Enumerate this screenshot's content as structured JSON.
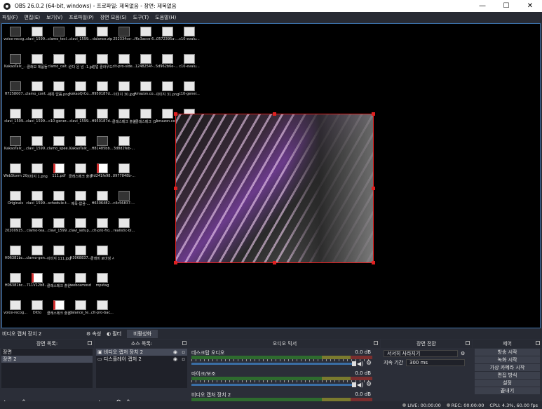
{
  "window": {
    "title": "OBS 26.0.2 (64-bit, windows) - 프로파일: 제목없음 - 장면: 제목없음",
    "minimize": "—",
    "maximize": "☐",
    "close": "✕"
  },
  "menu": [
    "파일(F)",
    "편집(E)",
    "보기(V)",
    "프로파일(P)",
    "장면 모음(S)",
    "도구(T)",
    "도움말(H)"
  ],
  "desktop_icons": [
    {
      "label": "voice-recog...",
      "col": 0,
      "row": 0
    },
    {
      "label": "clavi_1599...",
      "col": 1,
      "row": 0
    },
    {
      "label": "clamo_tecl...",
      "col": 2,
      "row": 0
    },
    {
      "label": "clavi_1599...",
      "col": 3,
      "row": 0
    },
    {
      "label": "dalance.zip",
      "col": 4,
      "row": 0
    },
    {
      "label": "252334ce-...",
      "col": 5,
      "row": 0
    },
    {
      "label": "f6c3acce-6...",
      "col": 6,
      "row": 0
    },
    {
      "label": "0572395a-...",
      "col": 7,
      "row": 0
    },
    {
      "label": "c10-evalu...",
      "col": 8,
      "row": 0
    },
    {
      "label": "KakaoTalk_...",
      "col": 0,
      "row": 1
    },
    {
      "label": "클래모 제품들",
      "col": 1,
      "row": 1
    },
    {
      "label": "clamo_calt...",
      "col": 2,
      "row": 1
    },
    {
      "label": "완다 운 넘 -1.jpg",
      "col": 3,
      "row": 1
    },
    {
      "label": "협업 클라우드",
      "col": 4,
      "row": 1
    },
    {
      "label": "clt-pro-side...",
      "col": 5,
      "row": 1
    },
    {
      "label": "1248254f-...",
      "col": 6,
      "row": 1
    },
    {
      "label": "5d962b6e-... (1).jpg",
      "col": 7,
      "row": 1
    },
    {
      "label": "c10-evalu...",
      "col": 8,
      "row": 1
    },
    {
      "label": "H7258007...",
      "col": 0,
      "row": 2
    },
    {
      "label": "clamo_cont...",
      "col": 1,
      "row": 2
    },
    {
      "label": "제목 없음.png",
      "col": 2,
      "row": 2
    },
    {
      "label": "kakaoQrCo...",
      "col": 3,
      "row": 2
    },
    {
      "label": "H950187d...",
      "col": 4,
      "row": 2
    },
    {
      "label": "이미지 30.jpg",
      "col": 5,
      "row": 2
    },
    {
      "label": "Amazon.co... Hd Webca...",
      "col": 6,
      "row": 2
    },
    {
      "label": "이미지 31.png",
      "col": 7,
      "row": 2
    },
    {
      "label": "c10-gener...",
      "col": 8,
      "row": 2
    },
    {
      "label": "clavi_1599...",
      "col": 0,
      "row": 3
    },
    {
      "label": "clavi_1599...",
      "col": 1,
      "row": 3
    },
    {
      "label": "c10-gener...",
      "col": 2,
      "row": 3
    },
    {
      "label": "clavi_1599...",
      "col": 3,
      "row": 3
    },
    {
      "label": "H950187d...",
      "col": 4,
      "row": 3
    },
    {
      "label": "클래스메크 출원중-2.jpg",
      "col": 5,
      "row": 3
    },
    {
      "label": "(클래스메크 (1-itv-1)",
      "col": 6,
      "row": 3
    },
    {
      "label": "Amazon.co... Hd Webca...",
      "col": 7,
      "row": 3
    },
    {
      "label": "이미지 32.png",
      "col": 8,
      "row": 3
    },
    {
      "label": "KakaoTalk_...",
      "col": 0,
      "row": 4
    },
    {
      "label": "clavi_1599...",
      "col": 1,
      "row": 4
    },
    {
      "label": "clamo_spee...",
      "col": 2,
      "row": 4
    },
    {
      "label": "KakaoTalk_...",
      "col": 3,
      "row": 4
    },
    {
      "label": "H81485bb...",
      "col": 4,
      "row": 4
    },
    {
      "label": "3d8d2feb-...",
      "col": 5,
      "row": 4
    },
    {
      "label": "WebStorm 2020.2.2 x64",
      "col": 0,
      "row": 5
    },
    {
      "label": "이미지 1.png",
      "col": 1,
      "row": 5
    },
    {
      "label": "111.pdf",
      "col": 2,
      "row": 5
    },
    {
      "label": "클래스메크 출원중-3.jpg",
      "col": 3,
      "row": 5
    },
    {
      "label": "Hd241fe98...",
      "col": 4,
      "row": 5
    },
    {
      "label": "0977848b-...",
      "col": 5,
      "row": 5
    },
    {
      "label": "Originals",
      "col": 0,
      "row": 6
    },
    {
      "label": "clavi_1599...",
      "col": 1,
      "row": 6
    },
    {
      "label": "schedule-t...",
      "col": 2,
      "row": 6
    },
    {
      "label": "제목-없음-...",
      "col": 3,
      "row": 6
    },
    {
      "label": "H6306482...",
      "col": 4,
      "row": 6
    },
    {
      "label": "c4c56837-...",
      "col": 5,
      "row": 6
    },
    {
      "label": "20200915...",
      "col": 0,
      "row": 7
    },
    {
      "label": "clamo-tea...",
      "col": 1,
      "row": 7
    },
    {
      "label": "clavi_1599...",
      "col": 2,
      "row": 7
    },
    {
      "label": "clavi_setup...",
      "col": 3,
      "row": 7
    },
    {
      "label": "clt-pro-fro...",
      "col": 4,
      "row": 7
    },
    {
      "label": "realistic-bl...",
      "col": 5,
      "row": 7
    },
    {
      "label": "H06381bc...",
      "col": 0,
      "row": 8
    },
    {
      "label": "clamo-gen...",
      "col": 1,
      "row": 8
    },
    {
      "label": "이미지 111.jpg",
      "col": 2,
      "row": 8
    },
    {
      "label": "H3068837...",
      "col": 3,
      "row": 8
    },
    {
      "label": "클래비 로마칭 사...",
      "col": 4,
      "row": 8
    },
    {
      "label": "H06381bc...",
      "col": 0,
      "row": 9
    },
    {
      "label": "711V12b8...",
      "col": 1,
      "row": 9
    },
    {
      "label": "클래스메크 출원중.pdf",
      "col": 2,
      "row": 9
    },
    {
      "label": "webcamosd",
      "col": 3,
      "row": 9
    },
    {
      "label": "mpstag",
      "col": 4,
      "row": 9
    },
    {
      "label": "voice-recog...",
      "col": 0,
      "row": 10
    },
    {
      "label": "Ditto",
      "col": 1,
      "row": 10
    },
    {
      "label": "클래스메크 출원중-1.jpg",
      "col": 2,
      "row": 10
    },
    {
      "label": "dalance_te...",
      "col": 3,
      "row": 10
    },
    {
      "label": "clt-pro-bac...",
      "col": 4,
      "row": 10
    }
  ],
  "source_bar": {
    "selected_source": "비디오 캡처 장치 2",
    "properties": "속성",
    "filters": "필터",
    "deactivate": "비활성화"
  },
  "scenes": {
    "header": "장면 목록:",
    "items": [
      "장면",
      "장면 2"
    ],
    "selected_index": 1
  },
  "sources": {
    "header": "소스 목록:",
    "items": [
      "비디오 캡처 장치 2",
      "디스플레이 캡처 2"
    ]
  },
  "mixer": {
    "header": "오디오 믹서",
    "channels": [
      {
        "name": "데스크탑 오디오",
        "db": "0.0 dB"
      },
      {
        "name": "마이크/보조",
        "db": "0.0 dB"
      },
      {
        "name": "비디오 캡처 장치 2",
        "db": "0.0 dB"
      }
    ]
  },
  "transitions": {
    "header": "장면 전환",
    "type": "서서히 사라지기",
    "duration_label": "지속 기간",
    "duration": "300 ms"
  },
  "controls": {
    "header": "제어",
    "buttons": [
      "방송 시작",
      "녹화 시작",
      "가상 카메라 시작",
      "편집 방식",
      "설정",
      "끝내기"
    ]
  },
  "status": {
    "live": "LIVE: 00:00:00",
    "rec": "REC: 00:00:00",
    "cpu": "CPU: 4.3%, 60.00 fps"
  },
  "icons": {
    "add": "+",
    "remove": "−",
    "up": "⌃",
    "down": "⌄",
    "settings": "⚙",
    "eye": "👁",
    "lock": "🔓",
    "speaker": "🔊"
  }
}
